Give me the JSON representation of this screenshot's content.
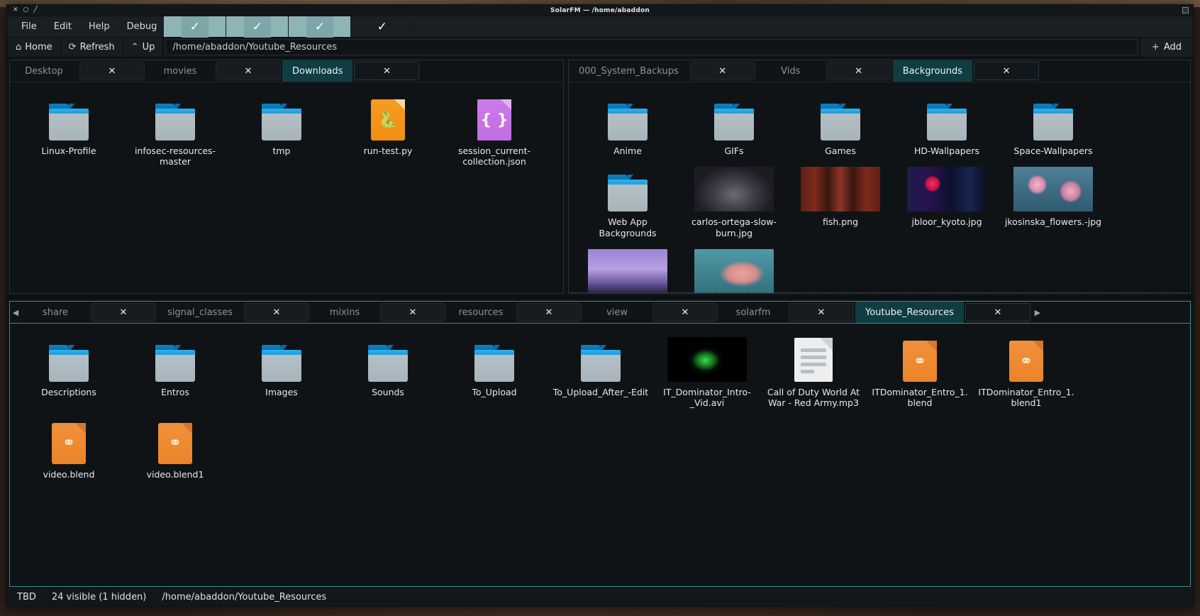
{
  "window": {
    "title": "SolarFM — /home/abaddon",
    "titlebar_buttons": [
      "✕",
      "○",
      "╱"
    ]
  },
  "menubar": {
    "items": [
      "File",
      "Edit",
      "Help",
      "Debug"
    ],
    "toggles": [
      {
        "name": "toggle-1",
        "checked": true,
        "glyph": "✓"
      },
      {
        "name": "toggle-2",
        "checked": true,
        "glyph": "✓"
      },
      {
        "name": "toggle-3",
        "checked": true,
        "glyph": "✓"
      },
      {
        "name": "toggle-4",
        "checked": false,
        "glyph": "✓"
      }
    ]
  },
  "navbar": {
    "home_label": "Home",
    "home_icon": "home-icon",
    "refresh_label": "Refresh",
    "refresh_icon": "refresh-icon",
    "up_label": "Up",
    "up_icon": "chevron-up-icon",
    "path_value": "/home/abaddon/Youtube_Resources",
    "path_placeholder": "/home/abaddon/Youtube_Resources",
    "add_label": "Add",
    "add_icon": "plus-icon"
  },
  "panes": {
    "top_left": {
      "tabs": [
        {
          "label": "Desktop",
          "active": false,
          "close": "✕"
        },
        {
          "label": "movies",
          "active": false,
          "close": "✕"
        },
        {
          "label": "Downloads",
          "active": true,
          "close": "✕"
        }
      ],
      "files": [
        {
          "name": "Linux-Profile",
          "kind": "folder"
        },
        {
          "name": "infosec-resources-master",
          "kind": "folder"
        },
        {
          "name": "tmp",
          "kind": "folder"
        },
        {
          "name": "run-test.py",
          "kind": "python",
          "glyph": "🐍"
        },
        {
          "name": "session_current-collection.json",
          "kind": "json",
          "glyph": "{ }"
        }
      ]
    },
    "top_right": {
      "tabs": [
        {
          "label": "000_System_Backups",
          "active": false,
          "close": "✕"
        },
        {
          "label": "Vids",
          "active": false,
          "close": "✕"
        },
        {
          "label": "Backgrounds",
          "active": true,
          "close": "✕"
        }
      ],
      "files": [
        {
          "name": "Anime",
          "kind": "folder"
        },
        {
          "name": "GIFs",
          "kind": "folder"
        },
        {
          "name": "Games",
          "kind": "folder"
        },
        {
          "name": "HD-Wallpapers",
          "kind": "folder"
        },
        {
          "name": "Space-Wallpapers",
          "kind": "folder"
        },
        {
          "name": "Web App Backgrounds",
          "kind": "folder"
        },
        {
          "name": "carlos-ortega-slow-burn.jpg",
          "kind": "thumb",
          "thumb": "t-carlos"
        },
        {
          "name": "fish.png",
          "kind": "thumb",
          "thumb": "t-fish"
        },
        {
          "name": "jbloor_kyoto.jpg",
          "kind": "thumb",
          "thumb": "t-kyoto"
        },
        {
          "name": "jkosinska_flowers.-jpg",
          "kind": "thumb",
          "thumb": "t-flowers"
        },
        {
          "name": "",
          "kind": "thumb-cut",
          "thumb": "t-purple"
        },
        {
          "name": "",
          "kind": "thumb-cut",
          "thumb": "t-teal"
        }
      ]
    },
    "bottom": {
      "scroll_left_icon": "◀",
      "scroll_right_icon": "▶",
      "tabs": [
        {
          "label": "share",
          "active": false,
          "close": "✕"
        },
        {
          "label": "signal_classes",
          "active": false,
          "close": "✕"
        },
        {
          "label": "mixins",
          "active": false,
          "close": "✕"
        },
        {
          "label": "resources",
          "active": false,
          "close": "✕"
        },
        {
          "label": "view",
          "active": false,
          "close": "✕"
        },
        {
          "label": "solarfm",
          "active": false,
          "close": "✕"
        },
        {
          "label": "Youtube_Resources",
          "active": true,
          "close": "✕"
        }
      ],
      "files": [
        {
          "name": "Descriptions",
          "kind": "folder"
        },
        {
          "name": "Entros",
          "kind": "folder"
        },
        {
          "name": "Images",
          "kind": "folder"
        },
        {
          "name": "Sounds",
          "kind": "folder"
        },
        {
          "name": "To_Upload",
          "kind": "folder"
        },
        {
          "name": "To_Upload_After_-Edit",
          "kind": "folder"
        },
        {
          "name": "IT_Dominator_Intro-_Vid.avi",
          "kind": "thumb",
          "thumb": "t-avi"
        },
        {
          "name": "Call of Duty World At War - Red Army.mp3",
          "kind": "generic"
        },
        {
          "name": "ITDominator_Entro_1.blend",
          "kind": "blend",
          "glyph": "blender"
        },
        {
          "name": "ITDominator_Entro_1.blend1",
          "kind": "blend",
          "glyph": "blender"
        },
        {
          "name": "video.blend",
          "kind": "blend",
          "glyph": "blender"
        },
        {
          "name": "video.blend1",
          "kind": "blend",
          "glyph": "blender"
        }
      ]
    }
  },
  "statusbar": {
    "state": "TBD",
    "count": "24 visible (1 hidden)",
    "path": "/home/abaddon/Youtube_Resources"
  },
  "colors": {
    "accent_teal": "#0f3d42",
    "accent_border": "#2f8f96",
    "toggle_on": "#8fb4b6",
    "folder_blue": "#1b9ad9",
    "folder_body": "#a7b4bb",
    "python_orange": "#ef8f13",
    "json_purple": "#c06de1"
  }
}
